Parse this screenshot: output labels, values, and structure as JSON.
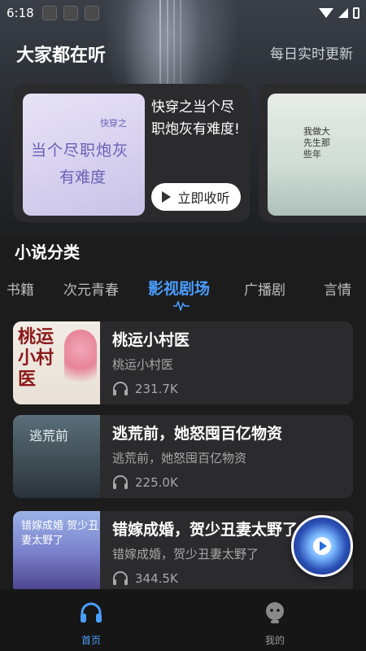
{
  "status_bar": {
    "time": "6:18"
  },
  "header": {
    "title": "大家都在听",
    "subtitle": "每日实时更新"
  },
  "featured": [
    {
      "title": "快穿之当个尽职炮灰有难度!",
      "cover_text_line1": "当个尽职炮灰",
      "cover_text_line2": "有难度",
      "cover_mark": "快穿之",
      "button_label": "立即收听"
    },
    {
      "cover_text": "我做大先生那些年"
    }
  ],
  "category": {
    "title": "小说分类",
    "tabs": [
      "书籍",
      "次元青春",
      "影视剧场",
      "广播剧",
      "言情"
    ],
    "active_tab": "影视剧场"
  },
  "books": [
    {
      "title": "桃运小村医",
      "subtitle": "桃运小村医",
      "plays": "231.7K",
      "cover_text": "桃运小村医"
    },
    {
      "title": "逃荒前，她怒囤百亿物资",
      "subtitle": "逃荒前，她怒囤百亿物资",
      "plays": "225.0K",
      "cover_text": "逃荒前"
    },
    {
      "title": "错嫁成婚，贺少丑妻太野了",
      "subtitle": "错嫁成婚，贺少丑妻太野了",
      "plays": "344.5K",
      "cover_text": "错嫁成婚 贺少丑妻太野了"
    }
  ],
  "bottom_nav": {
    "home": "首页",
    "mine": "我的"
  },
  "colors": {
    "accent": "#4a9eff",
    "card": "#2b2b2d",
    "background": "#1c1c1c"
  }
}
